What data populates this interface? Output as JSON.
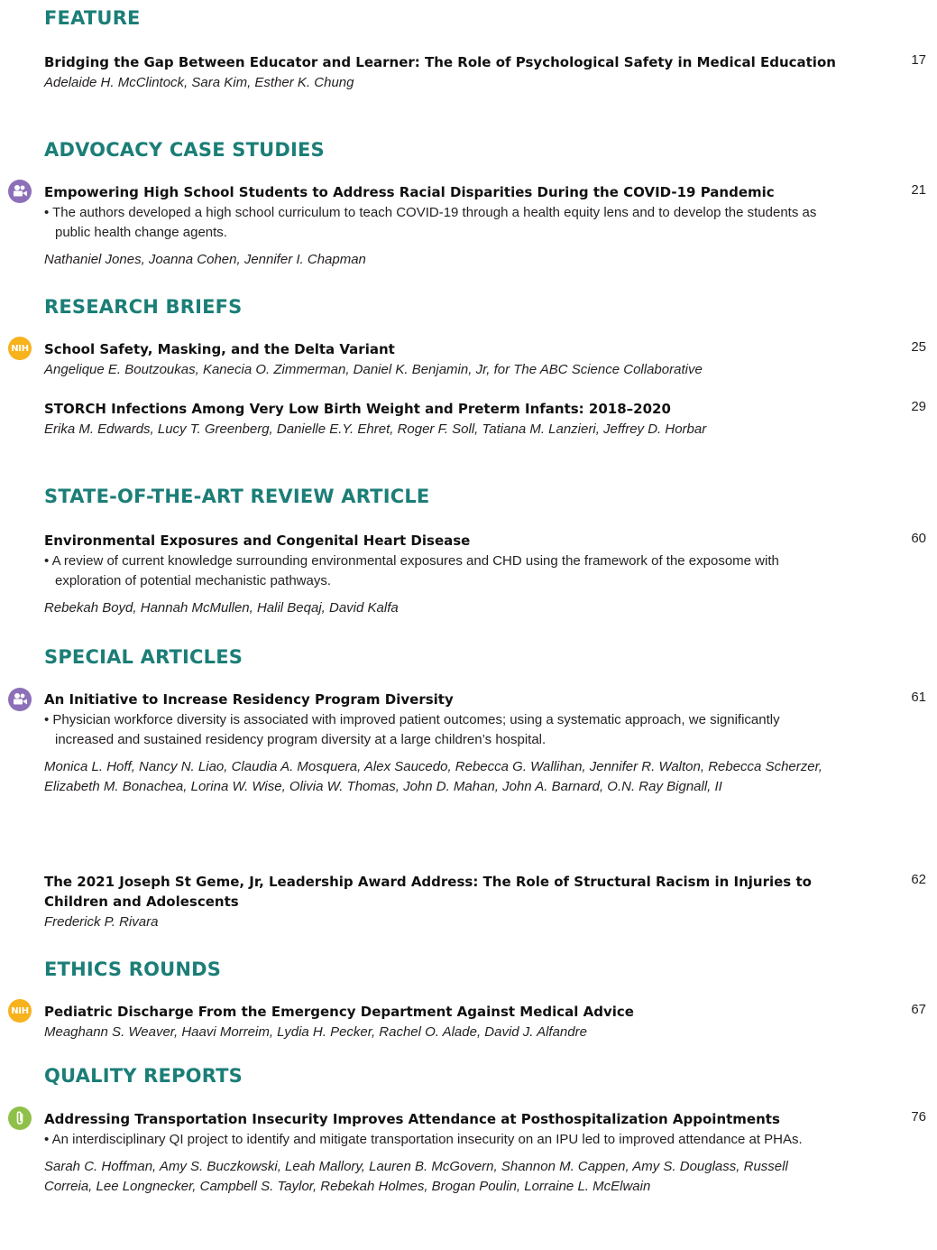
{
  "sections": [
    {
      "heading": "FEATURE",
      "entries": [
        {
          "title": "Bridging the Gap Between Educator and Learner: The Role of Psychological Safety in Medical Education",
          "page": "17",
          "authors": "Adelaide H. McClintock, Sara Kim, Esther K. Chung"
        }
      ]
    },
    {
      "heading": "ADVOCACY CASE STUDIES",
      "entries": [
        {
          "title": "Empowering High School Students to Address Racial Disparities During the COVID-19 Pandemic",
          "page": "21",
          "summary": "• The authors developed a high school curriculum to teach COVID-19 through a health equity lens and to develop the students as public health change agents.",
          "authors": "Nathaniel Jones, Joanna Cohen, Jennifer I. Chapman",
          "icon": "video-camera-icon"
        }
      ]
    },
    {
      "heading": "RESEARCH BRIEFS",
      "entries": [
        {
          "title": "School Safety, Masking, and the Delta Variant",
          "page": "25",
          "authors": "Angelique E. Boutzoukas, Kanecia O. Zimmerman, Daniel K. Benjamin, Jr, for The ABC Science Collaborative",
          "icon": "nih-icon"
        },
        {
          "title": "STORCH Infections Among Very Low Birth Weight and Preterm Infants: 2018–2020",
          "page": "29",
          "authors": "Erika M. Edwards, Lucy T. Greenberg, Danielle E.Y. Ehret, Roger F. Soll, Tatiana M. Lanzieri, Jeffrey D. Horbar"
        }
      ]
    },
    {
      "heading": "STATE-OF-THE-ART REVIEW ARTICLE",
      "entries": [
        {
          "title": "Environmental Exposures and Congenital Heart Disease",
          "page": "60",
          "summary": "• A review of current knowledge surrounding environmental exposures and CHD using the framework of the exposome with exploration of potential mechanistic pathways.",
          "authors": "Rebekah Boyd, Hannah McMullen, Halil Beqaj, David Kalfa"
        }
      ]
    },
    {
      "heading": "SPECIAL ARTICLES",
      "entries": [
        {
          "title": "An Initiative to Increase Residency Program Diversity",
          "page": "61",
          "summary": "• Physician workforce diversity is associated with improved patient outcomes; using a systematic approach, we significantly increased and sustained residency program diversity at a large children’s hospital.",
          "authors": "Monica L. Hoff, Nancy N. Liao, Claudia A. Mosquera, Alex Saucedo, Rebecca G. Wallihan, Jennifer R.  Walton, Rebecca Scherzer, Elizabeth M. Bonachea, Lorina W. Wise, Olivia W. Thomas, John D. Mahan, John A. Barnard, O.N. Ray Bignall,  II",
          "icon": "video-camera-icon"
        },
        {
          "title": "The 2021 Joseph St Geme, Jr, Leadership Award Address: The Role of Structural Racism in Injuries to Children and Adolescents",
          "page": "62",
          "authors": "Frederick P. Rivara"
        }
      ]
    },
    {
      "heading": "ETHICS ROUNDS",
      "entries": [
        {
          "title": "Pediatric Discharge From the Emergency Department Against Medical Advice",
          "page": "67",
          "authors": "Meaghann S. Weaver, Haavi Morreim, Lydia H. Pecker, Rachel O. Alade, David J. Alfandre",
          "icon": "nih-icon"
        }
      ]
    },
    {
      "heading": "QUALITY REPORTS",
      "entries": [
        {
          "title": "Addressing Transportation Insecurity Improves Attendance at Posthospitalization Appointments",
          "page": "76",
          "summary": "• An interdisciplinary QI project to identify and mitigate transportation insecurity on an IPU led to improved attendance at PHAs.",
          "authors": "Sarah C. Hoffman, Amy S. Buczkowski, Leah Mallory, Lauren B. McGovern, Shannon M. Cappen, Amy S. Douglass, Russell Correia, Lee Longnecker, Campbell S. Taylor, Rebekah Holmes, Brogan Poulin, Lorraine L. McElwain",
          "icon": "paperclip-icon"
        }
      ]
    }
  ],
  "badges": {
    "nih_text": "NIH"
  },
  "colors": {
    "heading": "#1b7e77",
    "video_badge": "#8c6fb8",
    "nih_badge": "#f7b21c",
    "qi_badge": "#8fc04a"
  }
}
